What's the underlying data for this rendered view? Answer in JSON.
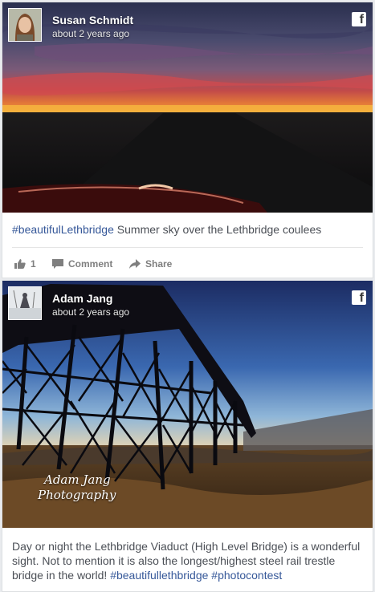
{
  "posts": [
    {
      "author": "Susan Schmidt",
      "time": "about 2 years ago",
      "caption_tag": "#beautifulLethbridge",
      "caption_text": " Summer sky over the Lethbridge coulees",
      "actions": {
        "like_count": "1",
        "comment_label": "Comment",
        "share_label": "Share"
      }
    },
    {
      "author": "Adam Jang",
      "time": "about 2 years ago",
      "watermark_line1": "Adam Jang",
      "watermark_line2": "Photography",
      "caption_text": "Day or night the Lethbridge Viaduct (High Level Bridge) is a wonderful sight. Not to mention it is also the longest/highest steel rail trestle bridge in the world! ",
      "caption_tag1": "#beautifullethbridge",
      "caption_tag2": "#photocontest"
    }
  ],
  "icons": {
    "facebook": "f"
  },
  "colors": {
    "link": "#365899",
    "action_gray": "#7f7f7f"
  }
}
